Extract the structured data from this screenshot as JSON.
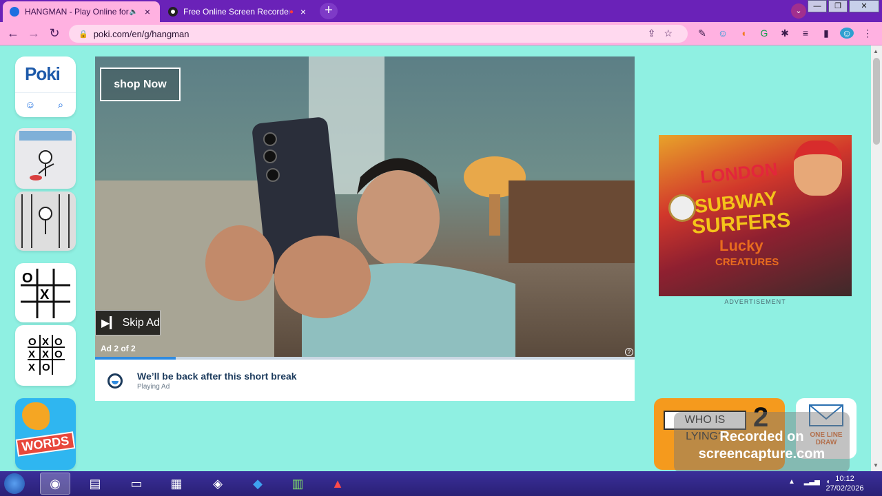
{
  "browser": {
    "tabs": [
      {
        "title": "HANGMAN - Play Online for",
        "active": true,
        "favicon_color": "#1e6fe0"
      },
      {
        "title": "Free Online Screen Recorder",
        "active": false,
        "favicon_color": "#222222"
      }
    ],
    "new_tab_label": "+",
    "url": "poki.com/en/g/hangman",
    "window_controls": {
      "minimize": "—",
      "maximize": "❐",
      "close": "✕"
    }
  },
  "sidebar": {
    "logo": "Poki",
    "games": [
      {
        "name": "hangman-thumbnail-1"
      },
      {
        "name": "hangman-thumbnail-2"
      },
      {
        "name": "tic-tac-toe-thumbnail-1",
        "grid": [
          "O",
          "",
          "",
          "",
          "X",
          "",
          "",
          "",
          ""
        ]
      },
      {
        "name": "tic-tac-toe-thumbnail-2",
        "grid": [
          "O",
          "X",
          "O",
          "X",
          "X",
          "O",
          "X",
          "O",
          ""
        ]
      },
      {
        "name": "words-thumbnail",
        "label": "WORDS"
      }
    ]
  },
  "video_ad": {
    "shop_button": "shop Now",
    "skip_button": "Skip Ad",
    "ad_counter": "Ad 2 of 2",
    "progress": 0.15,
    "break_title": "We’ll be back after this short break",
    "break_subtitle": "Playing Ad"
  },
  "side_ad": {
    "lines": [
      "LONDON",
      "SUBWAY",
      "SURFERS",
      "Lucky",
      "CREATURES"
    ],
    "label": "ADVERTISEMENT"
  },
  "cards": {
    "who_is_lying": {
      "question": "WHO IS LYING?",
      "number": "2"
    },
    "one_line_draw": {
      "label": "ONE LINE DRAW"
    }
  },
  "watermark": {
    "line1": "Recorded on",
    "line2": "screencapture.com"
  },
  "taskbar": {
    "time": "10:12",
    "date": "27/02/2026"
  }
}
